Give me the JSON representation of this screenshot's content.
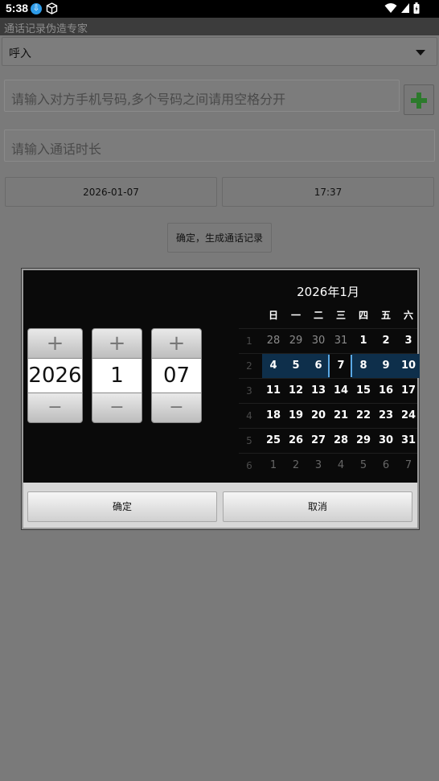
{
  "status_bar": {
    "time": "5:38",
    "icons": [
      "download-badge-icon",
      "cube-icon",
      "wifi-icon",
      "signal-icon",
      "battery-icon"
    ]
  },
  "app": {
    "title": "通话记录伪造专家"
  },
  "form": {
    "call_type": "呼入",
    "phone_placeholder": "请输入对方手机号码,多个号码之间请用空格分开",
    "duration_placeholder": "请输入通话时长",
    "date_value": "2026-01-07",
    "time_value": "17:37",
    "generate_label": "确定，生成通话记录"
  },
  "dialog": {
    "year": "2026",
    "month": "1",
    "day": "07",
    "calendar_title": "2026年1月",
    "weekdays": [
      "日",
      "一",
      "二",
      "三",
      "四",
      "五",
      "六"
    ],
    "weeks": [
      {
        "num": "1",
        "days": [
          "28",
          "29",
          "30",
          "31",
          "1",
          "2",
          "3"
        ]
      },
      {
        "num": "2",
        "days": [
          "4",
          "5",
          "6",
          "7",
          "8",
          "9",
          "10"
        ]
      },
      {
        "num": "3",
        "days": [
          "11",
          "12",
          "13",
          "14",
          "15",
          "16",
          "17"
        ]
      },
      {
        "num": "4",
        "days": [
          "18",
          "19",
          "20",
          "21",
          "22",
          "23",
          "24"
        ]
      },
      {
        "num": "5",
        "days": [
          "25",
          "26",
          "27",
          "28",
          "29",
          "30",
          "31"
        ]
      },
      {
        "num": "6",
        "days": [
          "1",
          "2",
          "3",
          "4",
          "5",
          "6",
          "7"
        ]
      }
    ],
    "ok_label": "确定",
    "cancel_label": "取消"
  }
}
